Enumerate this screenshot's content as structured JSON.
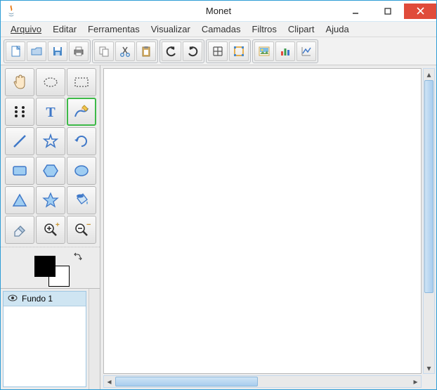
{
  "window": {
    "title": "Monet"
  },
  "menu": {
    "arquivo": "Arquivo",
    "editar": "Editar",
    "ferramentas": "Ferramentas",
    "visualizar": "Visualizar",
    "camadas": "Camadas",
    "filtros": "Filtros",
    "clipart": "Clipart",
    "ajuda": "Ajuda"
  },
  "tools": {
    "hand": "hand",
    "marquee_ellipse": "marquee-ellipse",
    "marquee_rect": "marquee-rect",
    "dots": "dots",
    "text": "text",
    "draw": "draw",
    "line": "line",
    "star_outline": "star-outline",
    "rotate": "rotate",
    "rect": "rect",
    "hexagon": "hexagon",
    "ellipse": "ellipse",
    "triangle": "triangle",
    "star_fill": "star",
    "bucket": "bucket",
    "eraser": "eraser",
    "zoom_in": "zoom-in",
    "zoom_out": "zoom-out",
    "selected": "draw"
  },
  "colors": {
    "fg": "#000000",
    "bg": "#ffffff"
  },
  "layers": {
    "items": [
      {
        "name": "Fundo 1",
        "visible": true
      }
    ]
  }
}
